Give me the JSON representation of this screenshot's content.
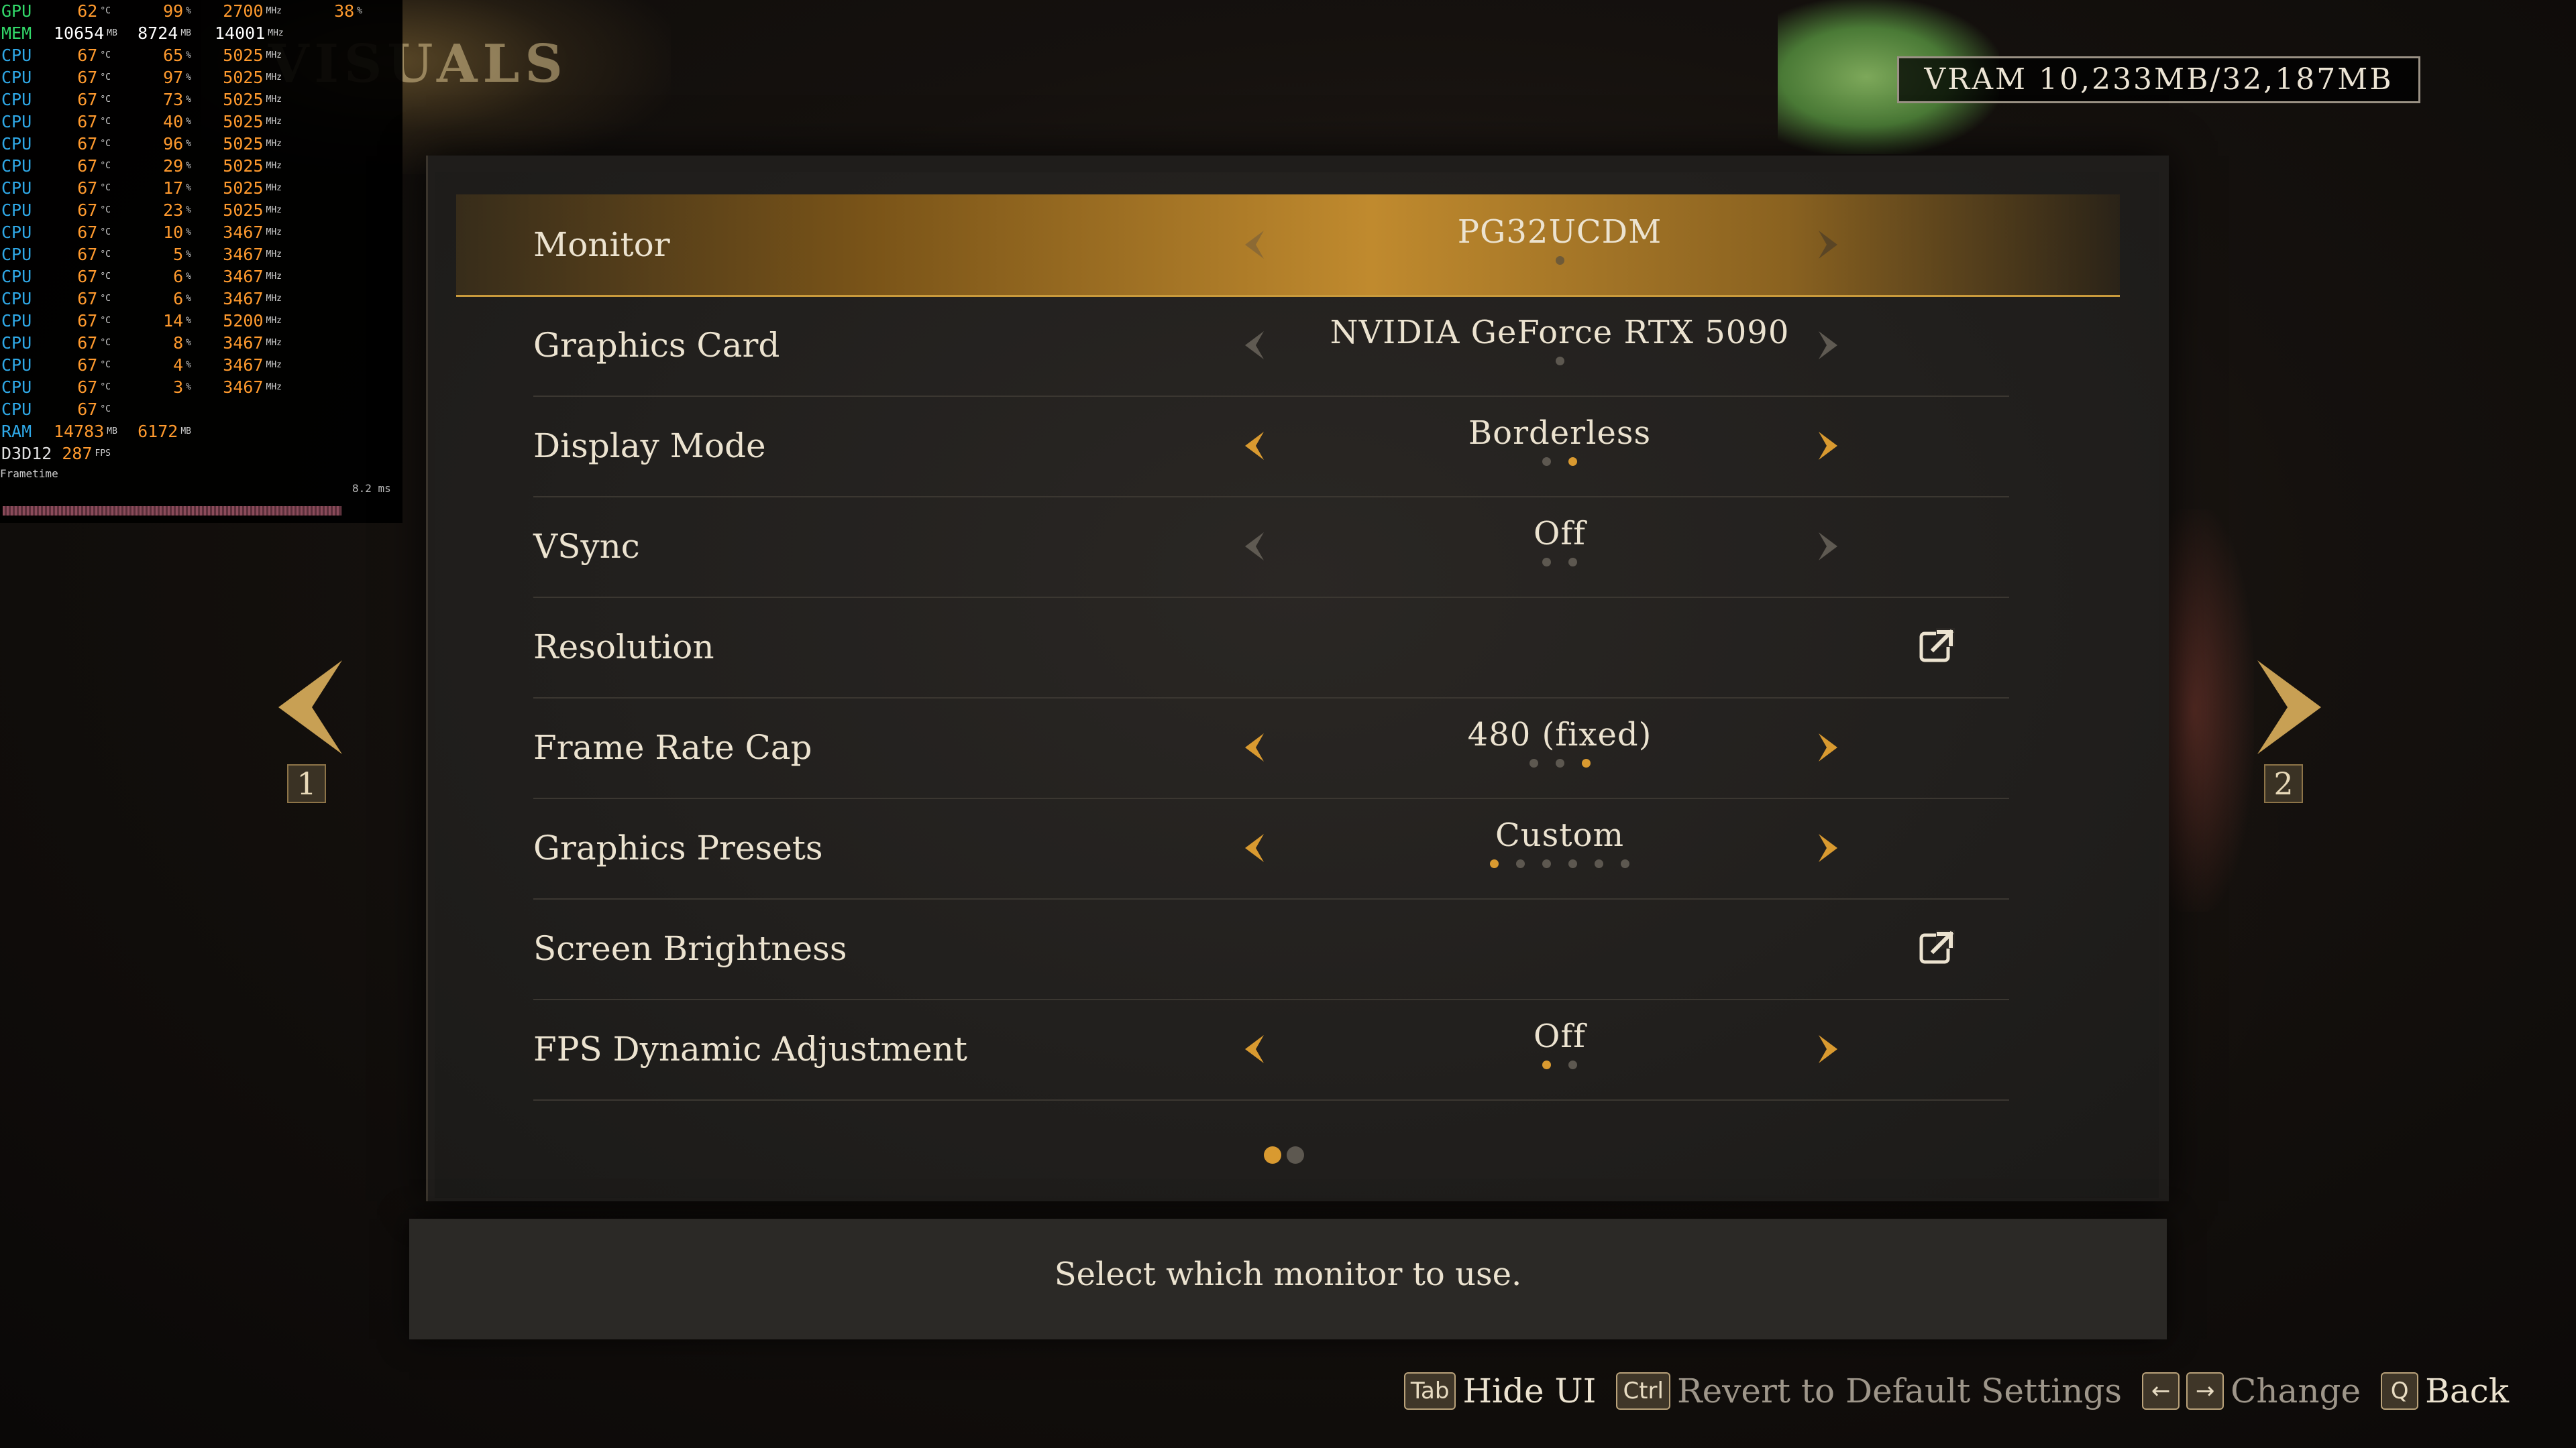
{
  "page": {
    "title": "VISUALS",
    "vram_text": "VRAM 10,233MB/32,187MB"
  },
  "overlay": {
    "rows": [
      {
        "label": "GPU",
        "v1": "62",
        "u1": "°C",
        "v2": "99",
        "u2": "%",
        "v3": "2700",
        "u3": "MHz",
        "v4": "38",
        "u4": "%"
      },
      {
        "label": "MEM",
        "v1": "10654",
        "u1": "MB",
        "v2": "8724",
        "u2": "MB",
        "v3": "14001",
        "u3": "MHz",
        "v4": "",
        "u4": ""
      },
      {
        "label": "CPU",
        "v1": "67",
        "u1": "°C",
        "v2": "65",
        "u2": "%",
        "v3": "5025",
        "u3": "MHz",
        "v4": "",
        "u4": ""
      },
      {
        "label": "CPU",
        "v1": "67",
        "u1": "°C",
        "v2": "97",
        "u2": "%",
        "v3": "5025",
        "u3": "MHz",
        "v4": "",
        "u4": ""
      },
      {
        "label": "CPU",
        "v1": "67",
        "u1": "°C",
        "v2": "73",
        "u2": "%",
        "v3": "5025",
        "u3": "MHz",
        "v4": "",
        "u4": ""
      },
      {
        "label": "CPU",
        "v1": "67",
        "u1": "°C",
        "v2": "40",
        "u2": "%",
        "v3": "5025",
        "u3": "MHz",
        "v4": "",
        "u4": ""
      },
      {
        "label": "CPU",
        "v1": "67",
        "u1": "°C",
        "v2": "96",
        "u2": "%",
        "v3": "5025",
        "u3": "MHz",
        "v4": "",
        "u4": ""
      },
      {
        "label": "CPU",
        "v1": "67",
        "u1": "°C",
        "v2": "29",
        "u2": "%",
        "v3": "5025",
        "u3": "MHz",
        "v4": "",
        "u4": ""
      },
      {
        "label": "CPU",
        "v1": "67",
        "u1": "°C",
        "v2": "17",
        "u2": "%",
        "v3": "5025",
        "u3": "MHz",
        "v4": "",
        "u4": ""
      },
      {
        "label": "CPU",
        "v1": "67",
        "u1": "°C",
        "v2": "23",
        "u2": "%",
        "v3": "5025",
        "u3": "MHz",
        "v4": "",
        "u4": ""
      },
      {
        "label": "CPU",
        "v1": "67",
        "u1": "°C",
        "v2": "10",
        "u2": "%",
        "v3": "3467",
        "u3": "MHz",
        "v4": "",
        "u4": ""
      },
      {
        "label": "CPU",
        "v1": "67",
        "u1": "°C",
        "v2": "5",
        "u2": "%",
        "v3": "3467",
        "u3": "MHz",
        "v4": "",
        "u4": ""
      },
      {
        "label": "CPU",
        "v1": "67",
        "u1": "°C",
        "v2": "6",
        "u2": "%",
        "v3": "3467",
        "u3": "MHz",
        "v4": "",
        "u4": ""
      },
      {
        "label": "CPU",
        "v1": "67",
        "u1": "°C",
        "v2": "6",
        "u2": "%",
        "v3": "3467",
        "u3": "MHz",
        "v4": "",
        "u4": ""
      },
      {
        "label": "CPU",
        "v1": "67",
        "u1": "°C",
        "v2": "14",
        "u2": "%",
        "v3": "5200",
        "u3": "MHz",
        "v4": "",
        "u4": ""
      },
      {
        "label": "CPU",
        "v1": "67",
        "u1": "°C",
        "v2": "8",
        "u2": "%",
        "v3": "3467",
        "u3": "MHz",
        "v4": "",
        "u4": ""
      },
      {
        "label": "CPU",
        "v1": "67",
        "u1": "°C",
        "v2": "4",
        "u2": "%",
        "v3": "3467",
        "u3": "MHz",
        "v4": "",
        "u4": ""
      },
      {
        "label": "CPU",
        "v1": "67",
        "u1": "°C",
        "v2": "3",
        "u2": "%",
        "v3": "3467",
        "u3": "MHz",
        "v4": "",
        "u4": ""
      },
      {
        "label": "CPU",
        "v1": "67",
        "u1": "°C",
        "v2": "",
        "u2": "",
        "v3": "",
        "u3": "",
        "v4": "",
        "u4": ""
      },
      {
        "label": "RAM",
        "v1": "14783",
        "u1": "MB",
        "v2": "6172",
        "u2": "MB",
        "v3": "",
        "u3": "",
        "v4": "",
        "u4": ""
      },
      {
        "label": "D3D12",
        "v1": "287",
        "u1": "FPS",
        "v2": "",
        "u2": "",
        "v3": "",
        "u3": "",
        "v4": "",
        "u4": ""
      }
    ],
    "frametime_label": "Frametime",
    "frametime_ms": "8.2 ms"
  },
  "settings": [
    {
      "label": "Monitor",
      "value": "PG32UCDM",
      "type": "select",
      "dots": 1,
      "active": 0,
      "selected": true
    },
    {
      "label": "Graphics Card",
      "value": "NVIDIA GeForce RTX 5090",
      "type": "select",
      "dots": 1,
      "active": -1,
      "selected": false
    },
    {
      "label": "Display Mode",
      "value": "Borderless",
      "type": "select",
      "dots": 2,
      "active": 1,
      "selected": false
    },
    {
      "label": "VSync",
      "value": "Off",
      "type": "select",
      "dots": 2,
      "active": -1,
      "selected": false
    },
    {
      "label": "Resolution",
      "value": "",
      "type": "link",
      "dots": 0,
      "active": -1,
      "selected": false
    },
    {
      "label": "Frame Rate Cap",
      "value": "480 (fixed)",
      "type": "select",
      "dots": 3,
      "active": 2,
      "selected": false
    },
    {
      "label": "Graphics Presets",
      "value": "Custom",
      "type": "select",
      "dots": 6,
      "active": 0,
      "selected": false
    },
    {
      "label": "Screen Brightness",
      "value": "",
      "type": "link",
      "dots": 0,
      "active": -1,
      "selected": false
    },
    {
      "label": "FPS Dynamic Adjustment",
      "value": "Off",
      "type": "select",
      "dots": 2,
      "active": 0,
      "selected": false
    }
  ],
  "pagination": {
    "pages": 2,
    "current": 0,
    "left_num": "1",
    "right_num": "2"
  },
  "description": "Select which monitor to use.",
  "hints": [
    {
      "keys": [
        "Tab"
      ],
      "label": "Hide UI",
      "dim": false
    },
    {
      "keys": [
        "Ctrl"
      ],
      "label": "Revert to Default Settings",
      "dim": true
    },
    {
      "keys": [
        "←",
        "→"
      ],
      "label": "Change",
      "dim": true
    },
    {
      "keys": [
        "Q"
      ],
      "label": "Back",
      "dim": false
    }
  ],
  "colors": {
    "accent": "#d99a30",
    "selected_row": "#c08a2e",
    "text": "#ece3d0",
    "overlay_orange": "#ff9a2e"
  }
}
